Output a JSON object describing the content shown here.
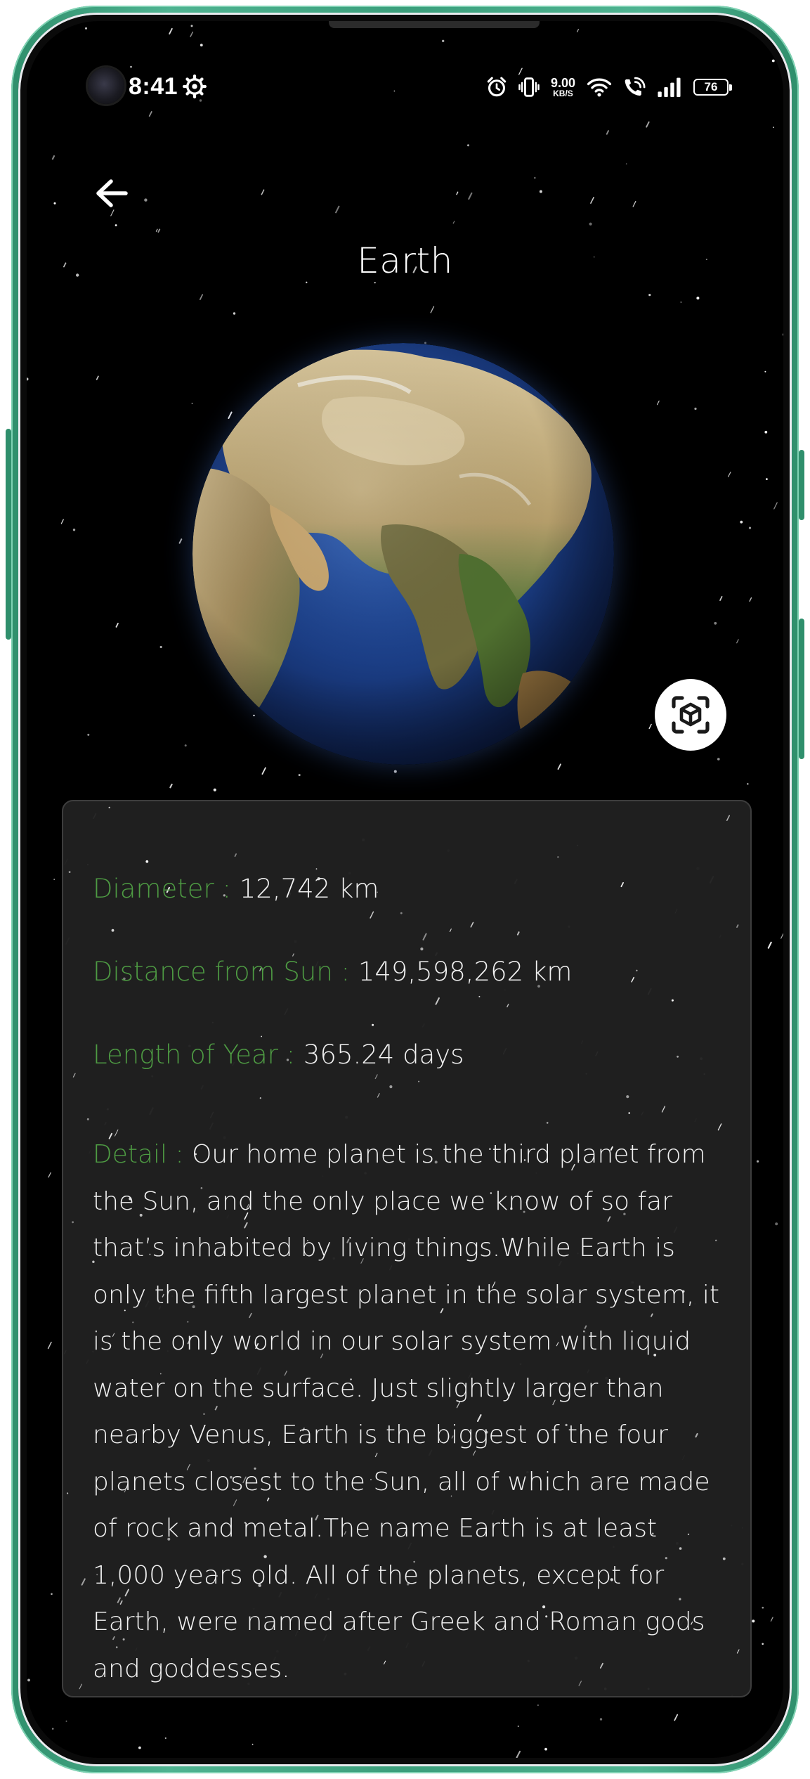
{
  "status_bar": {
    "time": "8:41",
    "net_speed_value": "9.00",
    "net_speed_unit": "KB/S",
    "battery_level": "76",
    "icons": [
      "settings-gear-icon",
      "alarm-icon",
      "vibrate-icon",
      "wifi-icon",
      "wifi-calling-icon",
      "signal-icon",
      "battery-icon"
    ]
  },
  "header": {
    "back_icon": "arrow-left-icon",
    "title": "Earth"
  },
  "planet_view": {
    "ar_button_icon": "ar-cube-icon"
  },
  "details": {
    "diameter_label": "Diameter :",
    "diameter_value": "12,742 km",
    "distance_label": "Distance from Sun :",
    "distance_value": "149,598,262 km",
    "year_label": "Length of Year :",
    "year_value": "365.24 days",
    "detail_label": "Detail :",
    "detail_text": "Our home planet is the third planet from the Sun, and the only place we know of so far that’s inhabited by living things.While Earth is only the fifth largest planet in the solar system, it is the only world in our solar system with liquid water on the surface. Just slightly larger than nearby Venus, Earth is the biggest of the four planets closest to the Sun, all of which are made of rock and metal.The name Earth is at least 1,000 years old. All of the planets, except for Earth, were named after Greek and Roman gods and goddesses."
  },
  "colors": {
    "background": "#000000",
    "label_green": "#4e9b43",
    "text": "#f1f1f1",
    "card": "#202020",
    "frame": "#3b9e7b"
  }
}
